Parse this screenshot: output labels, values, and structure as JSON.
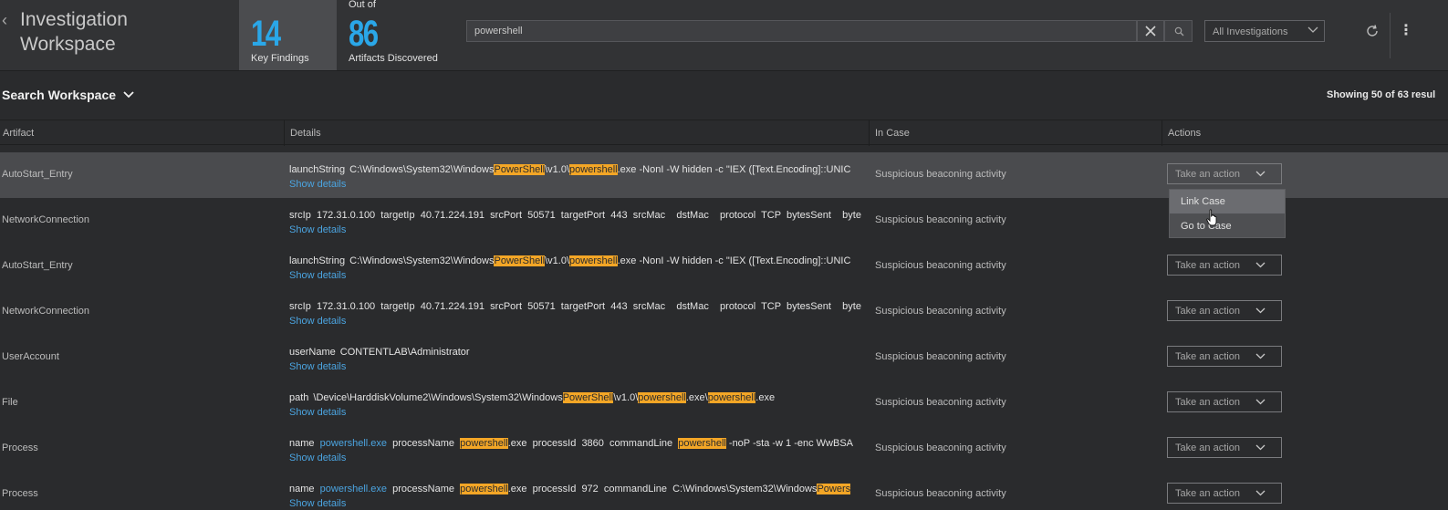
{
  "header": {
    "title_line1": "Investigation",
    "title_line2": "Workspace",
    "key_findings": {
      "count": "14",
      "label": "Key Findings"
    },
    "artifacts": {
      "prefix": "Out of",
      "count": "86",
      "label": "Artifacts Discovered"
    },
    "search": {
      "value": "powershell"
    },
    "scope_select": {
      "selected": "All Investigations"
    }
  },
  "subheader": {
    "title": "Search Workspace",
    "results": "Showing 50 of 63 resul"
  },
  "table": {
    "columns": [
      "Artifact",
      "Details",
      "In Case",
      "Actions"
    ],
    "show_details_label": "Show details",
    "action_placeholder": "Take an action",
    "rows": [
      {
        "artifact": "AutoStart_Entry",
        "in_case": "Suspicious beaconing activity"
      },
      {
        "artifact": "NetworkConnection",
        "in_case": "Suspicious beaconing activity"
      },
      {
        "artifact": "AutoStart_Entry",
        "in_case": "Suspicious beaconing activity"
      },
      {
        "artifact": "NetworkConnection",
        "in_case": "Suspicious beaconing activity"
      },
      {
        "artifact": "UserAccount",
        "in_case": "Suspicious beaconing activity"
      },
      {
        "artifact": "File",
        "in_case": "Suspicious beaconing activity"
      },
      {
        "artifact": "Process",
        "in_case": "Suspicious beaconing activity"
      },
      {
        "artifact": "Process",
        "in_case": "Suspicious beaconing activity"
      }
    ],
    "details": {
      "autostart": {
        "key": "launchString",
        "p1": "C:\\Windows\\System32\\Windows",
        "h1": "PowerShell",
        "p2": "\\v1.0\\",
        "h2": "powershell",
        "p3": ".exe -NonI -W hidden -c \"IEX ([Text.Encoding]::UNIC"
      },
      "netconn": {
        "text": "srcIp  172.31.0.100  targetIp  40.71.224.191  srcPort  50571  targetPort  443  srcMac    dstMac    protocol  TCP  bytesSent    byte"
      },
      "user": {
        "key": "userName",
        "value": "CONTENTLAB\\Administrator"
      },
      "file": {
        "key": "path",
        "p1": "\\Device\\HarddiskVolume2\\Windows\\System32\\Windows",
        "h1": "PowerShell",
        "p2": "\\v1.0\\",
        "h2": "powershell",
        "p3": ".exe\\",
        "h3": "powershell",
        "p4": ".exe"
      },
      "process1": {
        "k1": "name",
        "link": "powershell.exe",
        "k2": "processName",
        "h1": "powershell",
        "p1": ".exe  processId  3860  commandLine",
        "h2": "powershell",
        "p2": " -noP -sta -w 1 -enc WwBSA"
      },
      "process2": {
        "k1": "name",
        "link": "powershell.exe",
        "k2": "processName",
        "h1": "powershell",
        "p1": ".exe  processId  972  commandLine  C:\\Windows\\System32\\Windows",
        "h2": "Powers"
      }
    }
  },
  "dropdown": {
    "items": [
      "Link Case",
      "Go to Case"
    ]
  },
  "colors": {
    "accent": "#2aa7e8",
    "highlight": "#f3a626",
    "link": "#4ba4e0"
  }
}
